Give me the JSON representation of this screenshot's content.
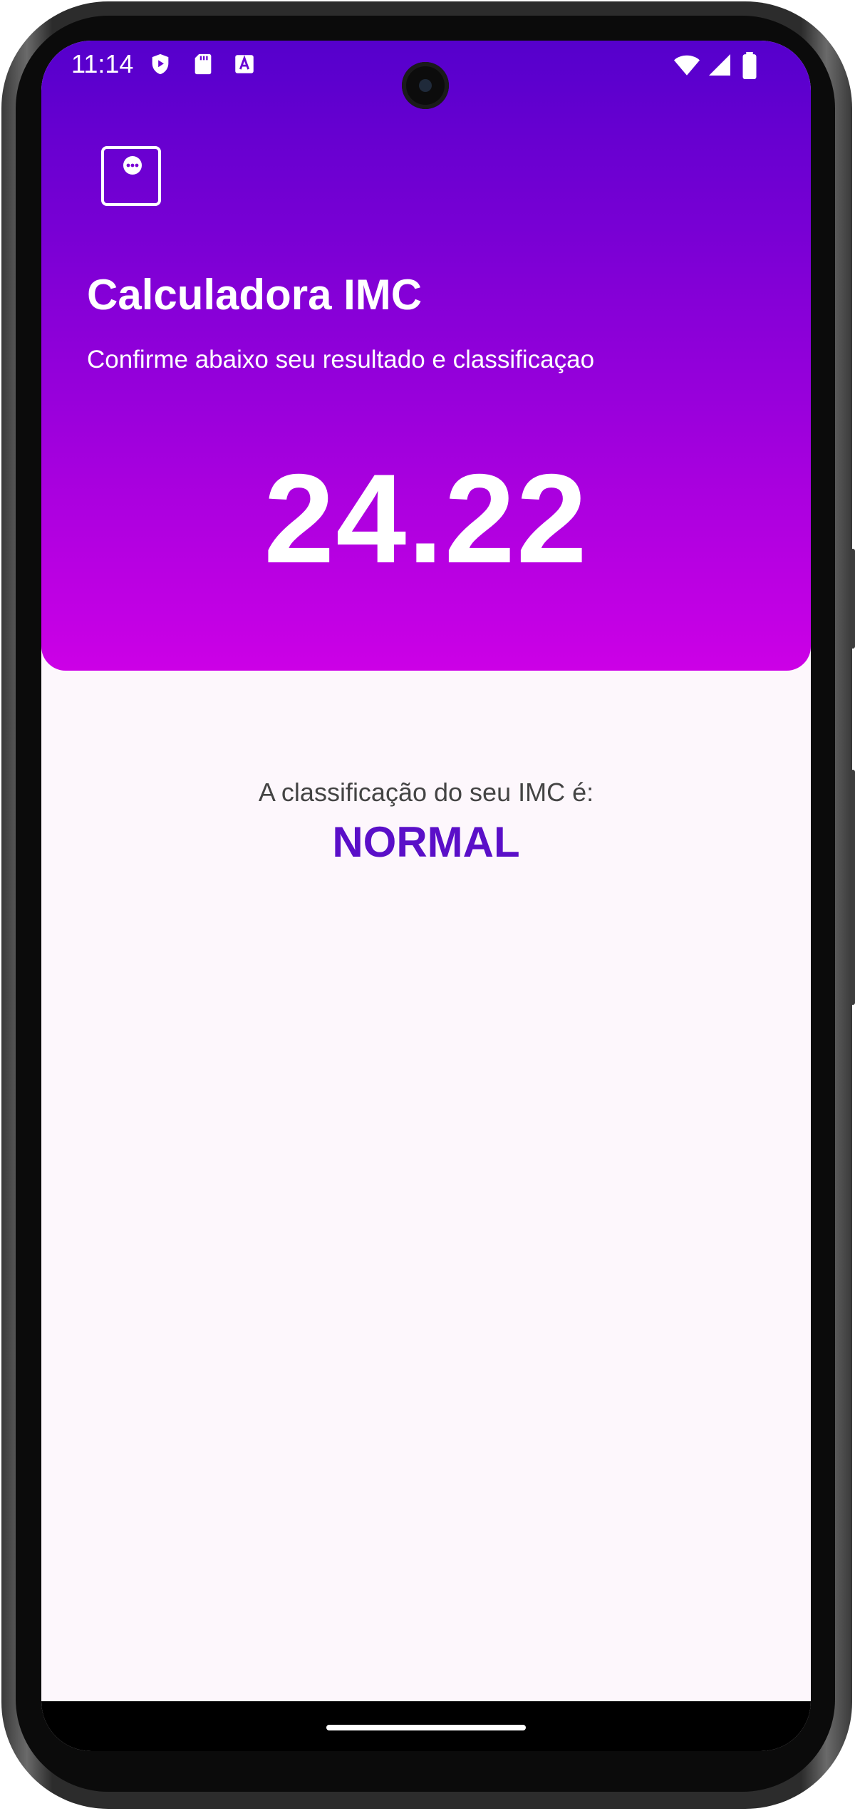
{
  "status_bar": {
    "time": "11:14",
    "left_icons": [
      "shield-play-icon",
      "sd-card-icon",
      "text-a-icon"
    ],
    "right_icons": [
      "wifi-icon",
      "cellular-signal-icon",
      "battery-icon"
    ]
  },
  "header": {
    "menu_icon": "dots-menu-icon",
    "title": "Calculadora IMC",
    "subtitle": "Confirme abaixo seu resultado e classificaçao",
    "bmi_value": "24.22",
    "gradient_top": "#5500cc",
    "gradient_bottom": "#cc00e6"
  },
  "result": {
    "label": "A classificação do seu IMC é:",
    "classification": "NORMAL",
    "classification_color": "#5a0fc8"
  }
}
